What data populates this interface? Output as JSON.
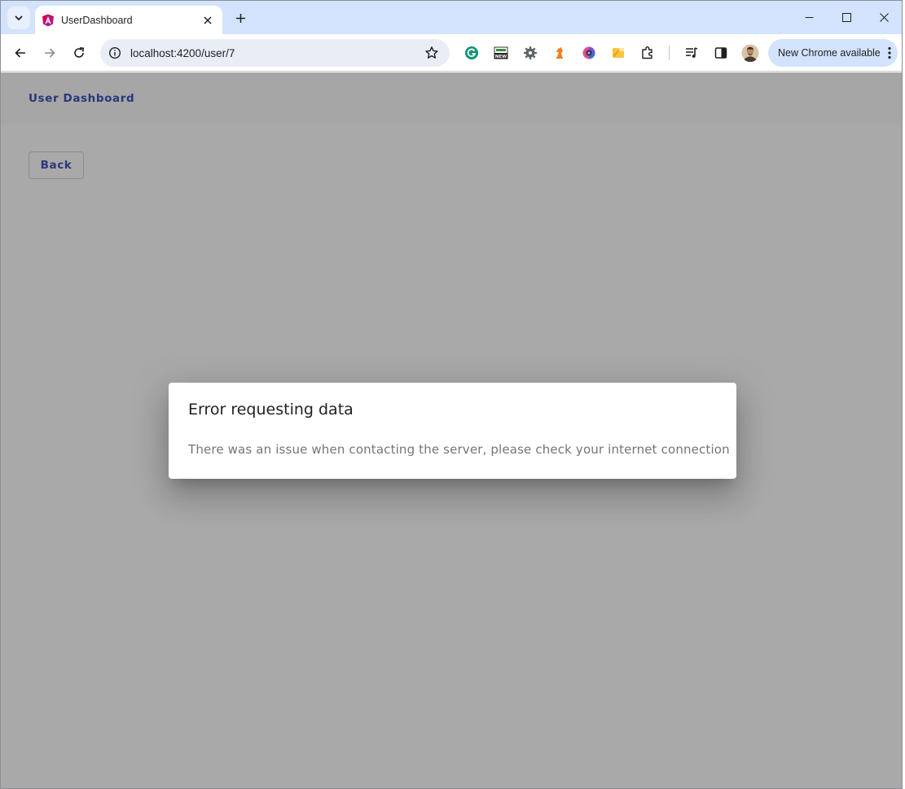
{
  "browser": {
    "tab": {
      "title": "UserDashboard"
    },
    "address_bar": {
      "url": "localhost:4200/user/7"
    },
    "update_button": {
      "label": "New Chrome available"
    },
    "icons": {
      "tab_search": "chevron-down-icon",
      "favicon": "angular-icon",
      "close_tab": "close-icon",
      "new_tab": "plus-icon",
      "minimize": "minimize-icon",
      "maximize": "maximize-icon",
      "close_window": "close-icon",
      "back": "arrow-left-icon",
      "forward": "arrow-right-icon",
      "reload": "reload-icon",
      "site_info": "info-icon",
      "bookmark": "star-icon",
      "extensions": [
        "grammarly-icon",
        "new-badge-icon",
        "gear-icon",
        "chess-knight-icon",
        "color-circle-icon",
        "folder-icon",
        "puzzle-icon"
      ],
      "media": "media-playlist-icon",
      "side_panel": "side-panel-icon",
      "profile": "avatar-icon",
      "menu": "kebab-menu-icon"
    }
  },
  "app": {
    "toolbar_title": "User Dashboard",
    "back_button": "Back"
  },
  "dialog": {
    "title": "Error requesting data",
    "message": "There was an issue when contacting the server, please check your internet connection"
  },
  "colors": {
    "primary": "#3f51b5",
    "tabstrip": "#d3e3fd",
    "backdrop": "rgba(0,0,0,0.32)"
  }
}
